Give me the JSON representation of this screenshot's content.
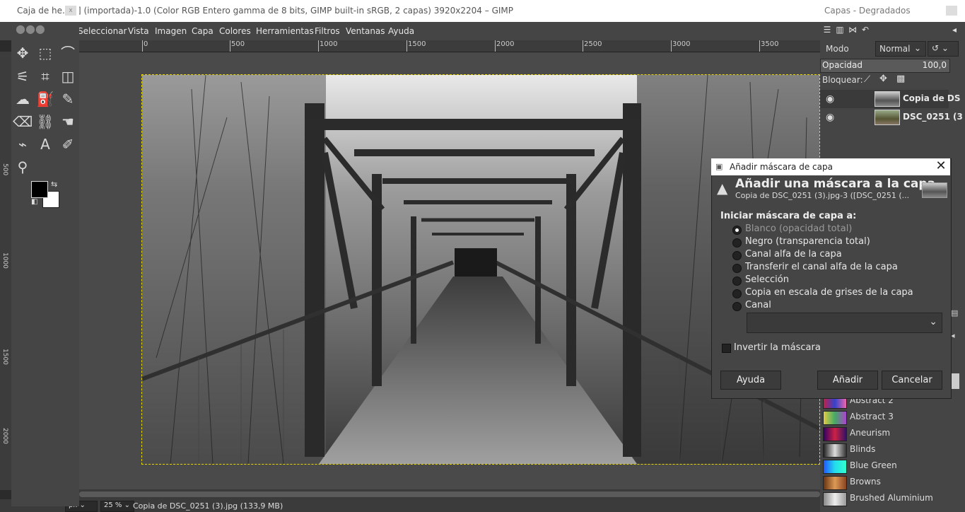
{
  "main_window": {
    "title": "] (importada)-1.0 (Color RGB Entero gamma de 8 bits, GIMP built-in sRGB, 2 capas) 3920x2204 – GIMP",
    "menu": [
      "Seleccionar",
      "Vista",
      "Imagen",
      "Capa",
      "Colores",
      "Herramientas",
      "Filtros",
      "Ventanas",
      "Ayuda"
    ],
    "ruler_labels": [
      "0",
      "500",
      "1000",
      "1500",
      "2000",
      "2500",
      "3000",
      "3500"
    ],
    "vruler_labels": [
      "500",
      "1000",
      "1500",
      "2000"
    ],
    "status": {
      "unit": "px",
      "zoom": "25 %",
      "message": "Copia de DSC_0251 (3).jpg (133,9 MB)"
    }
  },
  "toolbox": {
    "title": "Caja de he...",
    "close": "x"
  },
  "dock": {
    "title": "Capas - Degradados",
    "mode_label": "Modo",
    "mode_value": "Normal",
    "opacity_label": "Opacidad",
    "opacity_value": "100,0",
    "lock_label": "Bloquear:",
    "layers": [
      {
        "name": "Copia de DS"
      },
      {
        "name": "DSC_0251 (3"
      }
    ],
    "gradients": [
      {
        "name": "Abstract 2",
        "colors": [
          "#c0204a",
          "#3344cc",
          "#ee66aa"
        ]
      },
      {
        "name": "Abstract 3",
        "colors": [
          "#ddcc44",
          "#44aa66",
          "#aa44cc"
        ]
      },
      {
        "name": "Aneurism",
        "colors": [
          "#330066",
          "#cc2244",
          "#331166"
        ]
      },
      {
        "name": "Blinds",
        "colors": [
          "#222222",
          "#dddddd",
          "#333333"
        ]
      },
      {
        "name": "Blue Green",
        "colors": [
          "#2255ff",
          "#22ddee",
          "#33ffcc"
        ]
      },
      {
        "name": "Browns",
        "colors": [
          "#663311",
          "#dd9955",
          "#884422"
        ]
      },
      {
        "name": "Brushed Aluminium",
        "colors": [
          "#888888",
          "#eeeeee",
          "#999999"
        ]
      }
    ]
  },
  "dialog": {
    "window_title": "Añadir máscara de capa",
    "heading": "Añadir una máscara a la capa",
    "subheading": "Copia de DSC_0251 (3).jpg-3 ([DSC_0251 (...",
    "section_label": "Iniciar máscara de capa a:",
    "options": [
      {
        "label": "Blanco (opacidad total)",
        "selected": true
      },
      {
        "label": "Negro (transparencia total)",
        "selected": false
      },
      {
        "label": "Canal alfa de la capa",
        "selected": false
      },
      {
        "label": "Transferir el canal alfa de la capa",
        "selected": false
      },
      {
        "label": "Selección",
        "selected": false
      },
      {
        "label": "Copia en escala de grises de la capa",
        "selected": false
      },
      {
        "label": "Canal",
        "selected": false
      }
    ],
    "channel_value": "",
    "invert_label": "Invertir la máscara",
    "invert_checked": false,
    "buttons": {
      "help": "Ayuda",
      "add": "Añadir",
      "cancel": "Cancelar"
    }
  }
}
